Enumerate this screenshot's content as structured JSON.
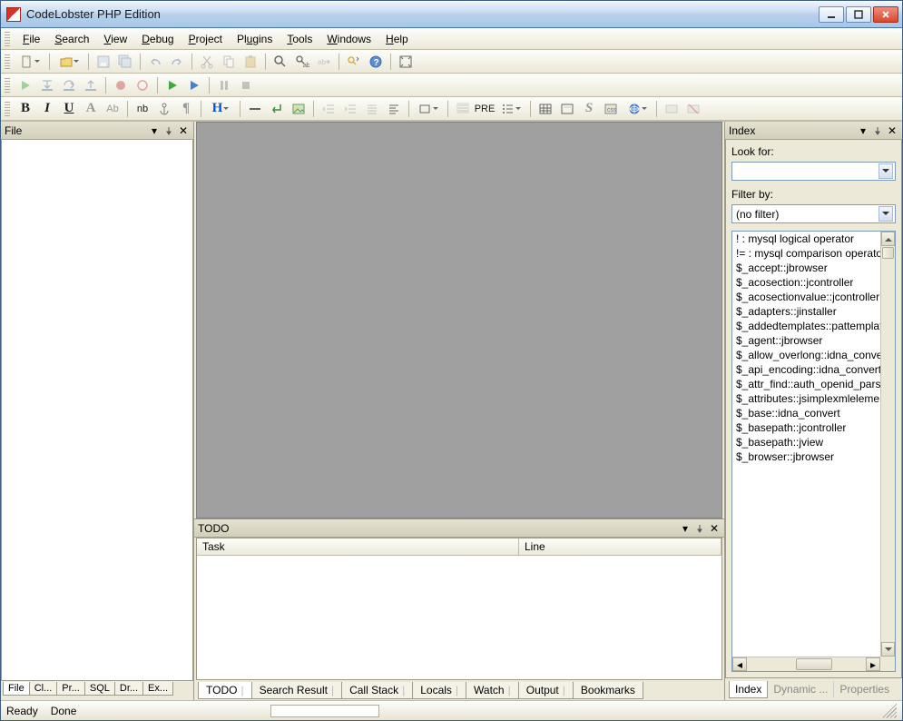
{
  "title": "CodeLobster PHP Edition",
  "menu": [
    "File",
    "Search",
    "View",
    "Debug",
    "Project",
    "Plugins",
    "Tools",
    "Windows",
    "Help"
  ],
  "left_panel": {
    "title": "File",
    "tabs": [
      "File",
      "Cl...",
      "Pr...",
      "SQL",
      "Dr...",
      "Ex..."
    ]
  },
  "bottom_panel": {
    "title": "TODO",
    "columns": [
      "Task",
      "Line"
    ],
    "tabs": [
      "TODO",
      "Search Result",
      "Call Stack",
      "Locals",
      "Watch",
      "Output",
      "Bookmarks"
    ]
  },
  "right_panel": {
    "title": "Index",
    "look_for_label": "Look for:",
    "look_for_value": "",
    "filter_by_label": "Filter by:",
    "filter_value": "(no filter)",
    "items": [
      "! : mysql logical operator",
      "!= : mysql comparison operator",
      "$_accept::jbrowser",
      "$_acosection::jcontroller",
      "$_acosectionvalue::jcontroller",
      "$_adapters::jinstaller",
      "$_addedtemplates::pattemplate",
      "$_agent::jbrowser",
      "$_allow_overlong::idna_convert",
      "$_api_encoding::idna_convert",
      "$_attr_find::auth_openid_parse",
      "$_attributes::jsimplexmlelement",
      "$_base::idna_convert",
      "$_basepath::jcontroller",
      "$_basepath::jview",
      "$_browser::jbrowser"
    ],
    "tabs": [
      "Index",
      "Dynamic ...",
      "Properties"
    ]
  },
  "status": {
    "state": "Ready",
    "task": "Done"
  }
}
